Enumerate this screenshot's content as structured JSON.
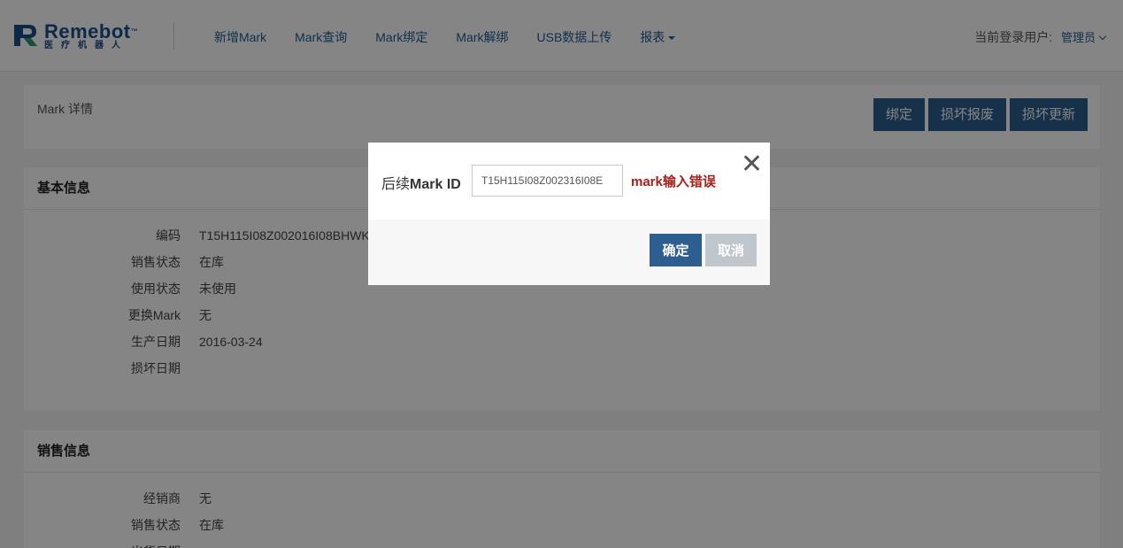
{
  "header": {
    "logo_name": "Remebot",
    "logo_tm": "™",
    "logo_sub": "医疗机器人",
    "nav": [
      "新增Mark",
      "Mark查询",
      "Mark绑定",
      "Mark解绑",
      "USB数据上传",
      "报表"
    ],
    "user_label": "当前登录用户:",
    "user_name": "管理员"
  },
  "top_panel": {
    "title": "Mark 详情",
    "buttons": [
      "绑定",
      "损坏报废",
      "损坏更新"
    ]
  },
  "basic_info": {
    "heading": "基本信息",
    "rows": [
      {
        "k": "编码",
        "v": "T15H115I08Z002016I08BHWK"
      },
      {
        "k": "销售状态",
        "v": "在库"
      },
      {
        "k": "使用状态",
        "v": "未使用"
      },
      {
        "k": "更换Mark",
        "v": "无"
      },
      {
        "k": "生产日期",
        "v": "2016-03-24"
      },
      {
        "k": "损坏日期",
        "v": ""
      }
    ]
  },
  "sales_info": {
    "heading": "销售信息",
    "rows": [
      {
        "k": "经销商",
        "v": "无"
      },
      {
        "k": "销售状态",
        "v": "在库"
      },
      {
        "k": "出货日期",
        "v": ""
      }
    ]
  },
  "modal": {
    "label_prefix": "后续",
    "label_bold": "Mark ID",
    "input_value": "T15H115I08Z002316I08E",
    "error": "mark输入错误",
    "close": "✕",
    "ok": "确定",
    "cancel": "取消"
  },
  "colors": {
    "brand": "#2c5f8f",
    "nav_link": "#1f5c93",
    "error": "#a6201b"
  }
}
